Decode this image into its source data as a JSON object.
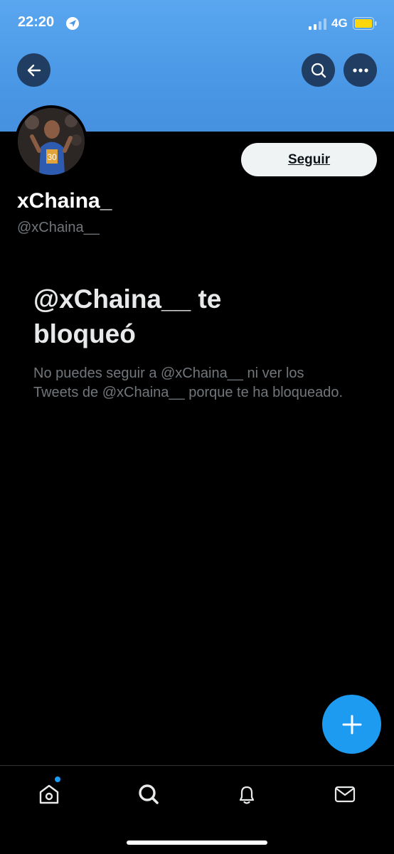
{
  "status_bar": {
    "time": "22:20",
    "network": "4G",
    "location_icon": "location-arrow-icon",
    "signal_icon": "signal-icon",
    "battery_icon": "battery-icon",
    "battery_color": "#ffd60a"
  },
  "header": {
    "back_icon": "arrow-left-icon",
    "search_icon": "search-icon",
    "more_icon": "more-horizontal-icon",
    "banner_color": "#4a98e6"
  },
  "profile": {
    "display_name": "xChaina_",
    "handle": "@xChaina__",
    "follow_label": "Seguir"
  },
  "blocked": {
    "title": "@xChaina__ te bloqueó",
    "message": "No puedes seguir a @xChaina__ ni ver los Tweets de @xChaina__ porque te ha bloqueado."
  },
  "fab": {
    "icon": "plus-icon",
    "color": "#1d9bf0"
  },
  "tabbar": {
    "items": [
      {
        "icon": "home-icon",
        "has_dot": true
      },
      {
        "icon": "search-icon"
      },
      {
        "icon": "bell-icon"
      },
      {
        "icon": "mail-icon"
      }
    ]
  }
}
